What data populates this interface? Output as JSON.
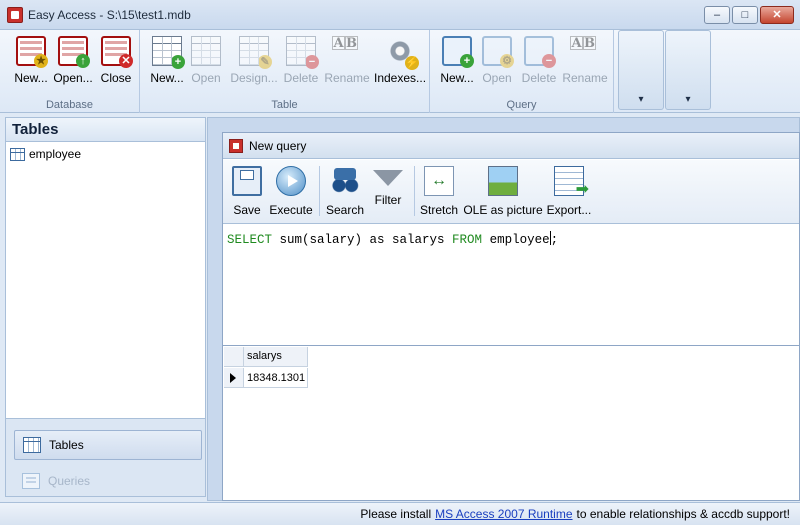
{
  "window": {
    "title": "Easy Access - S:\\15\\test1.mdb",
    "buttons": {
      "minimize": "–",
      "maximize": "□",
      "close": "✕"
    }
  },
  "ribbon": {
    "groups": [
      {
        "label": "Database",
        "buttons": [
          {
            "label": "New...",
            "icon": "new-database-icon",
            "enabled": true
          },
          {
            "label": "Open...",
            "icon": "open-database-icon",
            "enabled": true
          },
          {
            "label": "Close",
            "icon": "close-database-icon",
            "enabled": true
          }
        ]
      },
      {
        "label": "Table",
        "buttons": [
          {
            "label": "New...",
            "icon": "new-table-icon",
            "enabled": true
          },
          {
            "label": "Open",
            "icon": "open-table-icon",
            "enabled": false
          },
          {
            "label": "Design...",
            "icon": "design-table-icon",
            "enabled": false
          },
          {
            "label": "Delete",
            "icon": "delete-table-icon",
            "enabled": false
          },
          {
            "label": "Rename",
            "icon": "rename-table-icon",
            "enabled": false
          },
          {
            "label": "Indexes...",
            "icon": "indexes-icon",
            "enabled": true
          }
        ]
      },
      {
        "label": "Query",
        "buttons": [
          {
            "label": "New...",
            "icon": "new-query-icon",
            "enabled": true
          },
          {
            "label": "Open",
            "icon": "open-query-icon",
            "enabled": false
          },
          {
            "label": "Delete",
            "icon": "delete-query-icon",
            "enabled": false
          },
          {
            "label": "Rename",
            "icon": "rename-query-icon",
            "enabled": false
          }
        ]
      }
    ]
  },
  "left_panel": {
    "header": "Tables",
    "items": [
      {
        "label": "employee",
        "icon": "table-icon"
      }
    ],
    "tabs": [
      {
        "label": "Tables",
        "active": true,
        "icon": "tables-icon"
      },
      {
        "label": "Queries",
        "active": false,
        "icon": "queries-icon"
      }
    ]
  },
  "query_window": {
    "title": "New query",
    "toolbar": [
      {
        "label": "Save",
        "icon": "save-icon"
      },
      {
        "label": "Execute",
        "icon": "execute-icon"
      },
      {
        "label": "Search",
        "icon": "search-icon"
      },
      {
        "label": "Filter",
        "icon": "filter-icon"
      },
      {
        "label": "Stretch",
        "icon": "stretch-icon",
        "active": true
      },
      {
        "label": "OLE as picture",
        "icon": "ole-picture-icon"
      },
      {
        "label": "Export...",
        "icon": "export-icon"
      }
    ],
    "sql": {
      "kw_select": "SELECT",
      "expr": " sum(salary) as salarys ",
      "kw_from": "FROM",
      "table": " employee",
      "terminator": ";"
    },
    "grid": {
      "columns": [
        "salarys"
      ],
      "rows": [
        [
          "18348.1301"
        ]
      ]
    }
  },
  "status_bar": {
    "prefix": "Please install",
    "link": "MS Access 2007 Runtime",
    "suffix": "to enable relationships & accdb support!"
  },
  "colors": {
    "sql_keyword": "#1f8a1f",
    "link": "#1a3fbf"
  }
}
